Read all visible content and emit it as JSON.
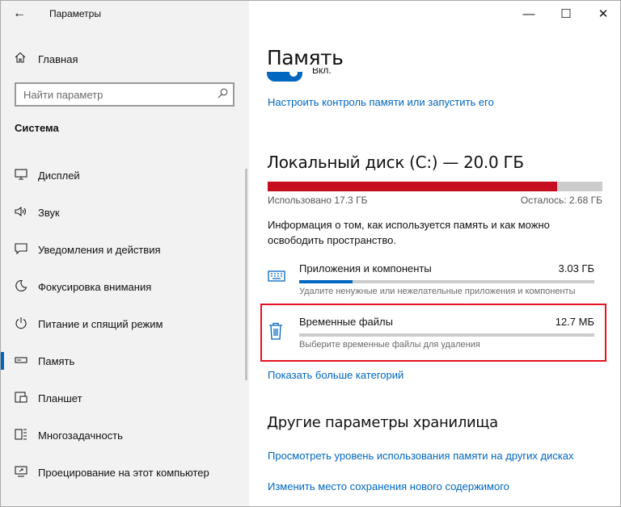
{
  "window": {
    "title": "Параметры"
  },
  "sidebar": {
    "home_label": "Главная",
    "search_placeholder": "Найти параметр",
    "section_title": "Система",
    "items": [
      {
        "label": "Дисплей",
        "icon": "display-icon"
      },
      {
        "label": "Звук",
        "icon": "sound-icon"
      },
      {
        "label": "Уведомления и действия",
        "icon": "notifications-icon"
      },
      {
        "label": "Фокусировка внимания",
        "icon": "focus-assist-icon"
      },
      {
        "label": "Питание и спящий режим",
        "icon": "power-icon"
      },
      {
        "label": "Память",
        "icon": "storage-icon",
        "active": true
      },
      {
        "label": "Планшет",
        "icon": "tablet-icon"
      },
      {
        "label": "Многозадачность",
        "icon": "multitasking-icon"
      },
      {
        "label": "Проецирование на этот компьютер",
        "icon": "projecting-icon"
      }
    ]
  },
  "main": {
    "title": "Память",
    "toggle_text_partial": "Вкл.",
    "storage_sense_link": "Настроить контроль памяти или запустить его",
    "drive": {
      "title": "Локальный диск (C:) — 20.0 ГБ",
      "used_label": "Использовано 17.3 ГБ",
      "free_label": "Осталось: 2.68 ГБ",
      "used_fraction": 0.865
    },
    "info_text": "Информация о том, как используется память и как можно освободить пространство.",
    "categories": [
      {
        "name": "Приложения и компоненты",
        "size": "3.03 ГБ",
        "description": "Удалите ненужные или нежелательные приложения и компоненты",
        "icon": "apps-icon",
        "fraction": 0.18
      },
      {
        "name": "Временные файлы",
        "size": "12.7 МБ",
        "description": "Выберите временные файлы для удаления",
        "icon": "trash-icon",
        "fraction": 0.0
      }
    ],
    "show_more_link": "Показать больше категорий",
    "other_title": "Другие параметры хранилища",
    "other_links": [
      "Просмотреть уровень использования памяти на других дисках",
      "Изменить место сохранения нового содержимого"
    ]
  },
  "colors": {
    "accent": "#0067c0",
    "used_bar": "#c50f1f",
    "highlight": "#e81123"
  }
}
